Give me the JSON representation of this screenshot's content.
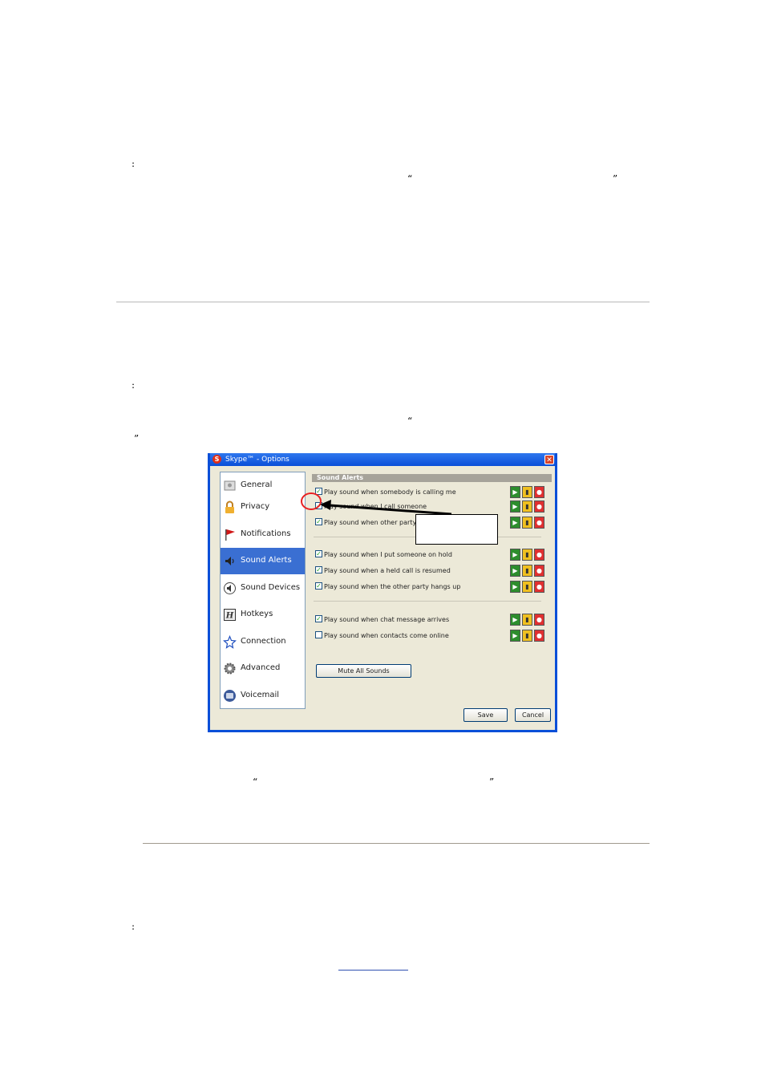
{
  "marks": {
    "colon_1": ":",
    "open_quote_1": "“",
    "close_quote_1": "”",
    "colon_2": ":",
    "open_quote_2": "“",
    "close_quote_2": "”",
    "open_quote_3": "“",
    "close_quote_3": "”",
    "colon_3": ":"
  },
  "dialog": {
    "title": "Skype™ - Options",
    "logo_letter": "S",
    "close_glyph": "✕",
    "nav": [
      {
        "label": "General",
        "icon": "general-icon",
        "active": false
      },
      {
        "label": "Privacy",
        "icon": "lock-icon",
        "active": false
      },
      {
        "label": "Notifications",
        "icon": "flag-icon",
        "active": false
      },
      {
        "label": "Sound Alerts",
        "icon": "speaker-icon",
        "active": true
      },
      {
        "label": "Sound Devices",
        "icon": "sound-devices-icon",
        "active": false
      },
      {
        "label": "Hotkeys",
        "icon": "hotkeys-icon",
        "active": false
      },
      {
        "label": "Connection",
        "icon": "connection-icon",
        "active": false
      },
      {
        "label": "Advanced",
        "icon": "gear-icon",
        "active": false
      },
      {
        "label": "Voicemail",
        "icon": "voicemail-icon",
        "active": false
      }
    ],
    "section_title": "Sound Alerts",
    "options": [
      {
        "label": "Play sound when somebody is calling me",
        "checked": true
      },
      {
        "label": "Play sound when I call someone",
        "checked": true
      },
      {
        "label": "Play sound when other party",
        "checked": true
      },
      {
        "label": "Play sound when I put someone on hold",
        "checked": true
      },
      {
        "label": "Play sound when a held call is resumed",
        "checked": true
      },
      {
        "label": "Play sound when the other party hangs up",
        "checked": true
      },
      {
        "label": "Play sound when chat message arrives",
        "checked": true
      },
      {
        "label": "Play sound when contacts come online",
        "checked": false
      }
    ],
    "check_glyph": "✓",
    "control_glyphs": {
      "play": "▶",
      "file": "▮",
      "remove": "●"
    },
    "mute_all_label": "Mute All Sounds",
    "save_label": "Save",
    "cancel_label": "Cancel"
  },
  "colors": {
    "title_bar": "#0a4fd8",
    "dialog_face": "#ece9d8",
    "nav_selected": "#3a6fd2",
    "highlight_circle": "#e82020"
  }
}
